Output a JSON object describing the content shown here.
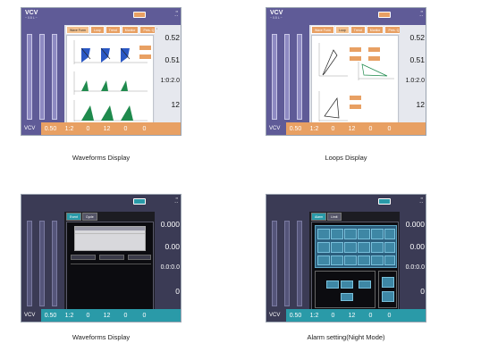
{
  "panels": [
    {
      "caption": "Waveforms Display",
      "mode": "VCV",
      "mode_sub": "~ 0.5 L ~",
      "tabs": [
        "Wave Form",
        "Loop",
        "Trend",
        "Monitor",
        "Pres. Q"
      ],
      "right_values": [
        "0.52",
        "0.51",
        "1:0:2.0",
        "12"
      ],
      "bottom": {
        "mode": "VCV",
        "params": [
          "0.50",
          "1:2",
          "0",
          "12",
          "0",
          "0"
        ]
      }
    },
    {
      "caption": "Loops Display",
      "mode": "VCV",
      "mode_sub": "~ 0.5 L ~",
      "tabs": [
        "Wave Form",
        "Loop",
        "Trend",
        "Monitor",
        "Pres. Q"
      ],
      "right_values": [
        "0.52",
        "0.51",
        "1.0:2.0",
        "12"
      ],
      "bottom": {
        "mode": "VCV",
        "params": [
          "0.50",
          "1:2",
          "0",
          "12",
          "0",
          "0"
        ]
      }
    },
    {
      "caption": "Waveforms Display",
      "mode": "",
      "tabs": [
        "Event",
        "Cycle"
      ],
      "right_values": [
        "0.000",
        "0.00",
        "0.0:0.0",
        "0"
      ],
      "bottom": {
        "mode": "VCV",
        "params": [
          "0.50",
          "1:2",
          "0",
          "12",
          "0",
          "0"
        ]
      }
    },
    {
      "caption": "Alarm setting(Night Mode)",
      "mode": "",
      "tabs": [
        "Alarm",
        "Limit"
      ],
      "right_values": [
        "0.000",
        "0.00",
        "0.0:0.0",
        "0"
      ],
      "bottom": {
        "mode": "VCV",
        "params": [
          "0.50",
          "1:2",
          "0",
          "12",
          "0",
          "0"
        ]
      }
    }
  ],
  "colors": {
    "header_purple": "#5f5b97",
    "accent_orange": "#e8a063",
    "waveform_green": "#1f8a4d",
    "night_teal": "#2a9aa8"
  }
}
